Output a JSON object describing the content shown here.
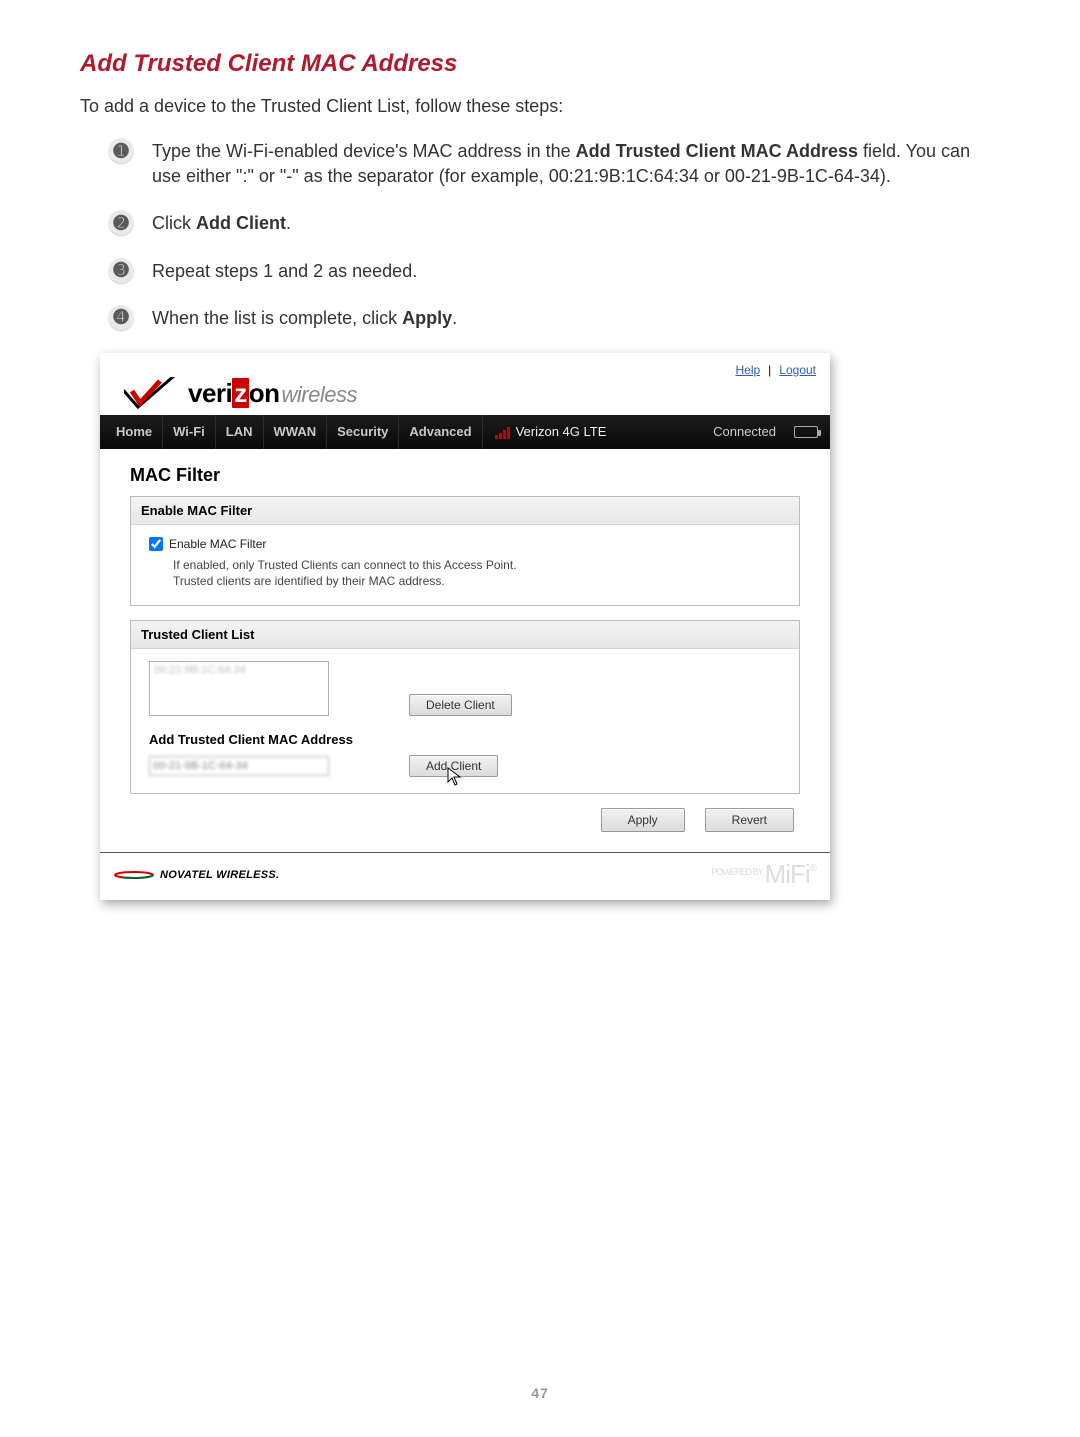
{
  "page": {
    "title": "Add Trusted Client MAC Address",
    "intro": "To add a device to the Trusted Client List, follow these steps:",
    "steps": [
      {
        "pre": "Type the Wi-Fi-enabled device's MAC address in the ",
        "bold1": "Add Trusted Client MAC Address",
        "post": " field. You can use either \":\" or \"-\" as the separator (for example, 00:21:9B:1C:64:34 or 00-21-9B-1C-64-34)."
      },
      {
        "pre": "Click ",
        "bold1": "Add Client",
        "post": "."
      },
      {
        "pre": "Repeat steps 1 and 2 as needed.",
        "bold1": "",
        "post": ""
      },
      {
        "pre": "When the list is complete, click ",
        "bold1": "Apply",
        "post": "."
      }
    ],
    "number": "47"
  },
  "shot": {
    "topLinks": {
      "help": "Help",
      "logout": "Logout"
    },
    "brand": {
      "veri": "veri",
      "z": "z",
      "on": "on",
      "wireless": "wireless"
    },
    "nav": {
      "tabs": [
        "Home",
        "Wi-Fi",
        "LAN",
        "WWAN",
        "Security",
        "Advanced"
      ],
      "carrier": "Verizon  4G LTE",
      "status": "Connected"
    },
    "heading": "MAC Filter",
    "panel1": {
      "hd": "Enable MAC Filter",
      "cb_label": "Enable MAC Filter",
      "note1": "If enabled, only Trusted Clients can connect to this Access Point.",
      "note2": "Trusted clients are identified by their MAC address."
    },
    "panel2": {
      "hd": "Trusted Client List",
      "delete_btn": "Delete Client",
      "sub_h": "Add Trusted Client MAC Address",
      "add_btn": "Add Client"
    },
    "actions": {
      "apply": "Apply",
      "revert": "Revert"
    },
    "footer": {
      "novatel": "NOVATEL WIRELESS.",
      "powered": "POWERED BY",
      "mifi": "MiFi"
    }
  }
}
